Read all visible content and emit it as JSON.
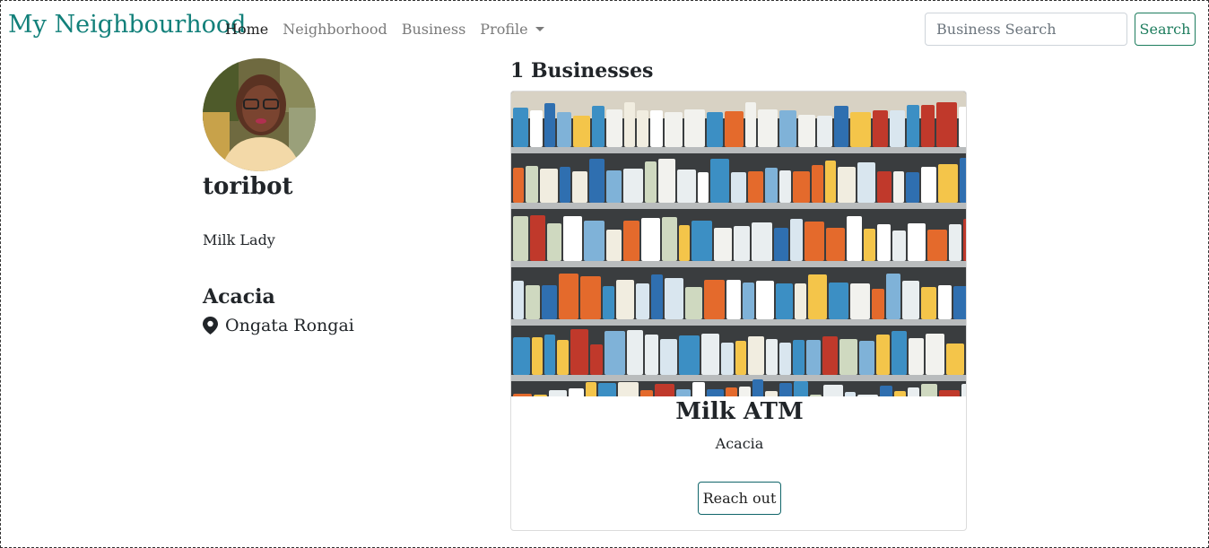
{
  "navbar": {
    "brand": "My Neighbourhood",
    "links": [
      "Home",
      "Neighborhood",
      "Business",
      "Profile"
    ],
    "search_placeholder": "Business Search",
    "search_button": "Search"
  },
  "profile": {
    "username": "toribot",
    "bio": "Milk Lady",
    "neighbourhood": "Acacia",
    "location": "Ongata Rongai"
  },
  "businesses": {
    "count_label": "1 Businesses",
    "items": [
      {
        "name": "Milk ATM",
        "neighbourhood": "Acacia",
        "button": "Reach out"
      }
    ]
  },
  "colors": {
    "brand": "#12807a",
    "search_button": "#1e7d5e",
    "reach_button_border": "#11666a"
  }
}
